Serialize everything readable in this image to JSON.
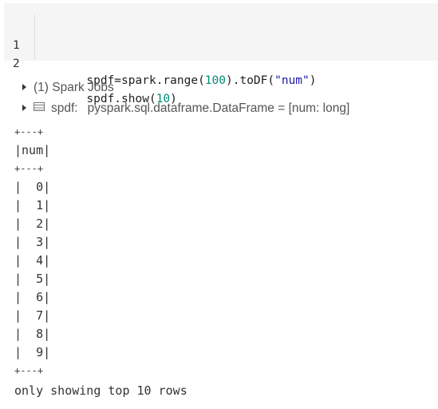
{
  "code_cell": {
    "lines": [
      {
        "number": "1",
        "tokens": [
          {
            "text": "spdf=spark.range(",
            "kind": "plain"
          },
          {
            "text": "100",
            "kind": "num"
          },
          {
            "text": ").toDF(",
            "kind": "plain"
          },
          {
            "text": "\"num\"",
            "kind": "str"
          },
          {
            "text": ")",
            "kind": "plain"
          }
        ]
      },
      {
        "number": "2",
        "tokens": [
          {
            "text": "spdf.show(",
            "kind": "plain"
          },
          {
            "text": "10",
            "kind": "num"
          },
          {
            "text": ")",
            "kind": "plain"
          }
        ]
      }
    ]
  },
  "output": {
    "jobs_label": "(1) Spark Jobs",
    "schema": {
      "name": "spdf:",
      "type": "pyspark.sql.dataframe.DataFrame = [num: long]"
    },
    "table": {
      "border": "+---+",
      "header": "|num|",
      "rows": [
        "|  0|",
        "|  1|",
        "|  2|",
        "|  3|",
        "|  4|",
        "|  5|",
        "|  6|",
        "|  7|",
        "|  8|",
        "|  9|"
      ]
    },
    "footer": "only showing top 10 rows"
  },
  "colors": {
    "code_background": "#f5f5f5",
    "number_token": "#008a7a",
    "string_token": "#1a1aa6",
    "output_text": "#333333"
  },
  "icons": {
    "expand": "caret-right-icon",
    "dataframe": "table-icon"
  }
}
